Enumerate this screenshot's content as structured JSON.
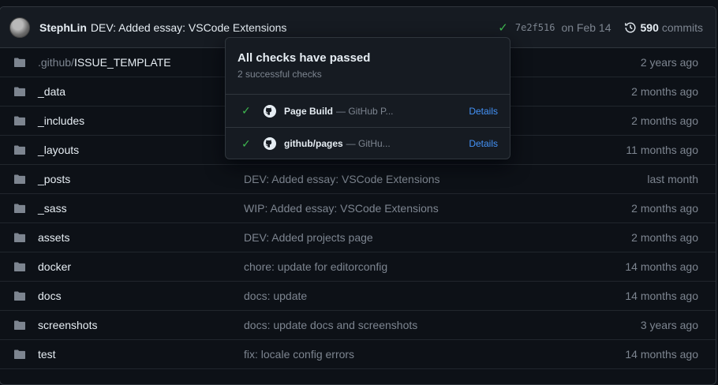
{
  "commit_bar": {
    "author": "StephLin",
    "message": "DEV: Added essay: VSCode Extensions",
    "status_icon": "check-icon",
    "sha": "7e2f516",
    "date": "on Feb 14",
    "history_icon": "history-icon",
    "commits_count": "590",
    "commits_label": "commits"
  },
  "files": [
    {
      "prefix": ".github/",
      "name": "ISSUE_TEMPLATE",
      "message": "",
      "time": "2 years ago"
    },
    {
      "prefix": "",
      "name": "_data",
      "message": "",
      "time": "2 months ago"
    },
    {
      "prefix": "",
      "name": "_includes",
      "message": "",
      "time": "2 months ago"
    },
    {
      "prefix": "",
      "name": "_layouts",
      "message": "",
      "time": "11 months ago"
    },
    {
      "prefix": "",
      "name": "_posts",
      "message": "DEV: Added essay: VSCode Extensions",
      "time": "last month"
    },
    {
      "prefix": "",
      "name": "_sass",
      "message": "WIP: Added essay: VSCode Extensions",
      "time": "2 months ago"
    },
    {
      "prefix": "",
      "name": "assets",
      "message": "DEV: Added projects page",
      "time": "2 months ago"
    },
    {
      "prefix": "",
      "name": "docker",
      "message": "chore: update for editorconfig",
      "time": "14 months ago"
    },
    {
      "prefix": "",
      "name": "docs",
      "message": "docs: update",
      "time": "14 months ago"
    },
    {
      "prefix": "",
      "name": "screenshots",
      "message": "docs: update docs and screenshots",
      "time": "3 years ago"
    },
    {
      "prefix": "",
      "name": "test",
      "message": "fix: locale config errors",
      "time": "14 months ago"
    }
  ],
  "checks_popover": {
    "title": "All checks have passed",
    "subtitle": "2 successful checks",
    "checks": [
      {
        "name": "Page Build",
        "description": "— GitHub P...",
        "link": "Details"
      },
      {
        "name": "github/pages",
        "description": "— GitHu...",
        "link": "Details"
      }
    ]
  },
  "colors": {
    "background": "#0d1117",
    "surface": "#161b22",
    "border": "#30363d",
    "success": "#3fb950",
    "link": "#4493f8",
    "muted": "#7d8590",
    "folder": "#7d8590"
  }
}
